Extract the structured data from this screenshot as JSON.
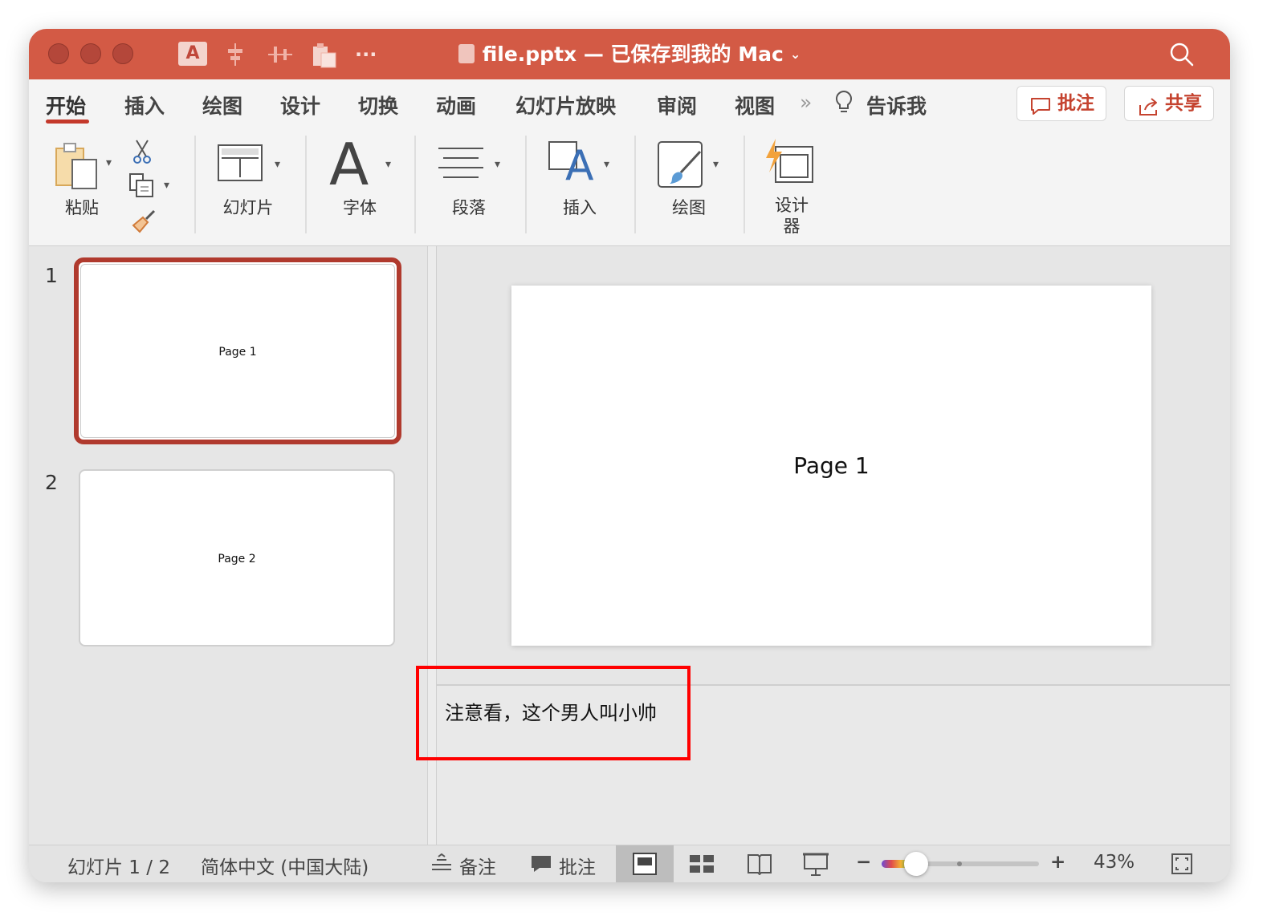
{
  "window": {
    "title": "file.pptx — 已保存到我的 Mac",
    "accent_color": "#d35a45",
    "quick_access": {
      "font_icon_letter": "A",
      "more": "···"
    }
  },
  "tabs": [
    {
      "label": "开始",
      "active": true
    },
    {
      "label": "插入"
    },
    {
      "label": "绘图"
    },
    {
      "label": "设计"
    },
    {
      "label": "切换"
    },
    {
      "label": "动画"
    },
    {
      "label": "幻灯片放映"
    },
    {
      "label": "审阅"
    },
    {
      "label": "视图"
    }
  ],
  "tabs_overflow": "»",
  "tell_me": "告诉我",
  "header_buttons": {
    "comments": "批注",
    "share": "共享"
  },
  "ribbon": {
    "paste": "粘贴",
    "slides": "幻灯片",
    "font": "字体",
    "font_glyph": "A",
    "paragraph": "段落",
    "insert": "插入",
    "insert_glyph": "A",
    "draw": "绘图",
    "designer_line1": "设计",
    "designer_line2": "器"
  },
  "thumbnails": [
    {
      "number": "1",
      "text": "Page 1",
      "selected": true
    },
    {
      "number": "2",
      "text": "Page 2",
      "selected": false
    }
  ],
  "slide": {
    "text": "Page 1"
  },
  "notes": {
    "text": "注意看，这个男人叫小帅"
  },
  "status_bar": {
    "slide_counter": "幻灯片 1 / 2",
    "language": "简体中文 (中国大陆)",
    "notes": "备注",
    "comments": "批注",
    "zoom_out": "−",
    "zoom_in": "+",
    "zoom_percent": "43%"
  },
  "highlight_color": "#ff0000"
}
